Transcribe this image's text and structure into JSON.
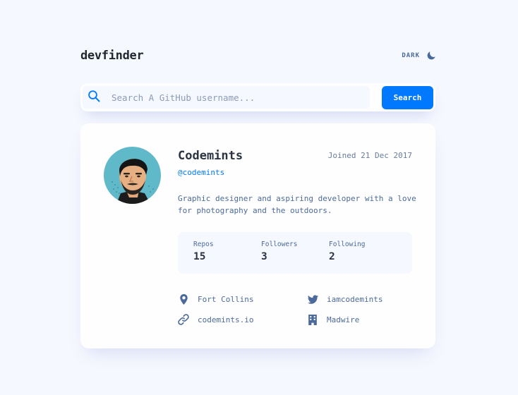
{
  "app": {
    "logo": "devfinder",
    "theme_toggle_label": "DARK"
  },
  "search": {
    "placeholder": "Search A GitHub username...",
    "value": "",
    "button_label": "Search"
  },
  "profile": {
    "name": "Codemints",
    "login": "@codemints",
    "joined": "Joined 21 Dec 2017",
    "bio": "Graphic designer and aspiring developer with a love for photography and the outdoors.",
    "stats": [
      {
        "label": "Repos",
        "value": "15"
      },
      {
        "label": "Followers",
        "value": "3"
      },
      {
        "label": "Following",
        "value": "2"
      }
    ],
    "links": {
      "location": "Fort Collins",
      "twitter": "iamcodemints",
      "blog": "codemints.io",
      "company": "Madwire"
    }
  },
  "colors": {
    "accent": "#0079ff",
    "background": "#f6f8ff",
    "card": "#fefefe",
    "text_dark": "#2b3442",
    "text_muted": "#4b6a9b"
  },
  "icons": {
    "search": "search-icon",
    "theme": "moon-icon",
    "location": "location-pin-icon",
    "twitter": "twitter-icon",
    "blog": "link-icon",
    "company": "building-icon"
  }
}
